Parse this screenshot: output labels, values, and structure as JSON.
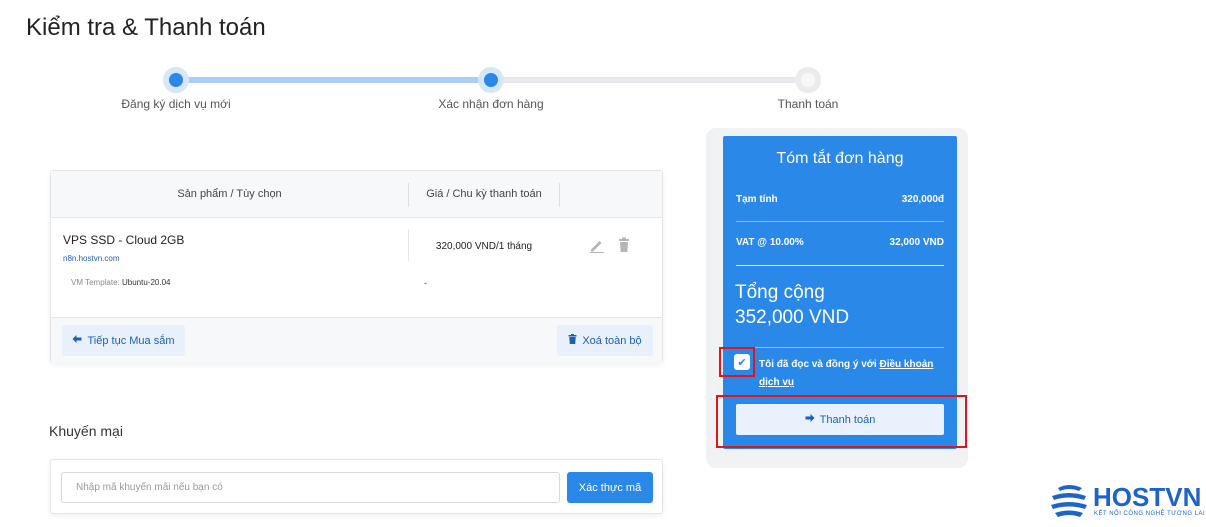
{
  "page": {
    "title": "Kiểm tra & Thanh toán"
  },
  "stepper": {
    "steps": [
      {
        "label": "Đăng ký dịch vụ mới",
        "state": "done"
      },
      {
        "label": "Xác nhận đơn hàng",
        "state": "current"
      },
      {
        "label": "Thanh toán",
        "state": "pending"
      }
    ]
  },
  "cart": {
    "columns": [
      "Sản phẩm / Tùy chọn",
      "Giá / Chu kỳ thanh toán"
    ],
    "items": [
      {
        "name": "VPS SSD - Cloud 2GB",
        "domain": "n8n.hostvn.com",
        "template_label": "VM Template:",
        "template_value": "Ubuntu-20.04",
        "price": "320,000 VND/1 tháng",
        "option_price": "-"
      }
    ],
    "continue_label": "Tiếp tục Mua sắm",
    "clear_label": "Xoá toàn bộ"
  },
  "promo": {
    "title": "Khuyến mại",
    "placeholder": "Nhập mã khuyến mãi nếu bạn có",
    "verify_label": "Xác thực mã"
  },
  "summary": {
    "title": "Tóm tắt đơn hàng",
    "subtotal_label": "Tạm tính",
    "subtotal_value": "320,000đ",
    "vat_label": "VAT @ 10.00%",
    "vat_value": "32,000 VND",
    "total_label": "Tổng cộng",
    "total_value": "352,000 VND",
    "agree_text": "Tôi đã đọc và đồng ý với",
    "terms_link": "Điều khoản dịch vụ",
    "agree_checked": true,
    "checkout_label": "Thanh toán"
  },
  "logo": {
    "name": "HOSTVN",
    "tagline": "KẾT NỐI CÔNG NGHỆ TƯƠNG LAI"
  },
  "colors": {
    "accent": "#2a88e8",
    "highlight": "#e0161d",
    "brand": "#1d64c6"
  }
}
